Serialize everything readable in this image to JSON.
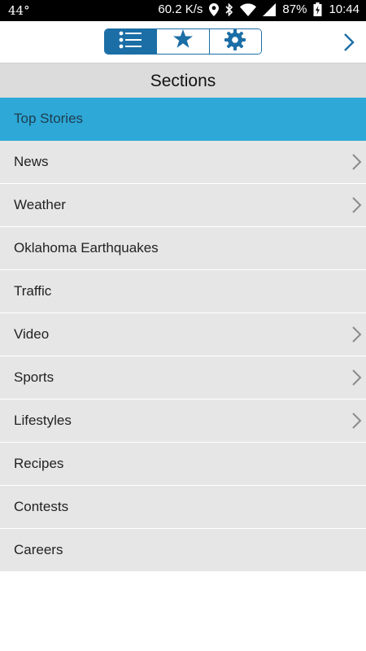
{
  "status_bar": {
    "temperature": "44°",
    "network_speed": "60.2 K/s",
    "battery": "87%",
    "time": "10:44",
    "icons": [
      "location-icon",
      "bluetooth-icon",
      "wifi-icon",
      "signal-icon",
      "battery-icon"
    ]
  },
  "toolbar": {
    "tabs": [
      {
        "icon": "list-icon",
        "active": true
      },
      {
        "icon": "star-icon",
        "active": false
      },
      {
        "icon": "gear-icon",
        "active": false
      }
    ],
    "next_icon": "chevron-right-icon"
  },
  "sections": {
    "title": "Sections",
    "items": [
      {
        "label": "Top Stories",
        "selected": true,
        "has_children": false
      },
      {
        "label": "News",
        "selected": false,
        "has_children": true
      },
      {
        "label": "Weather",
        "selected": false,
        "has_children": true
      },
      {
        "label": "Oklahoma Earthquakes",
        "selected": false,
        "has_children": false
      },
      {
        "label": "Traffic",
        "selected": false,
        "has_children": false
      },
      {
        "label": "Video",
        "selected": false,
        "has_children": true
      },
      {
        "label": "Sports",
        "selected": false,
        "has_children": true
      },
      {
        "label": "Lifestyles",
        "selected": false,
        "has_children": true
      },
      {
        "label": "Recipes",
        "selected": false,
        "has_children": false
      },
      {
        "label": "Contests",
        "selected": false,
        "has_children": false
      },
      {
        "label": "Careers",
        "selected": false,
        "has_children": false
      }
    ]
  },
  "colors": {
    "accent": "#1b6ea6",
    "selected_row": "#2ea8d7",
    "row_background": "#e6e6e6",
    "header_background": "#dcdcdc"
  }
}
